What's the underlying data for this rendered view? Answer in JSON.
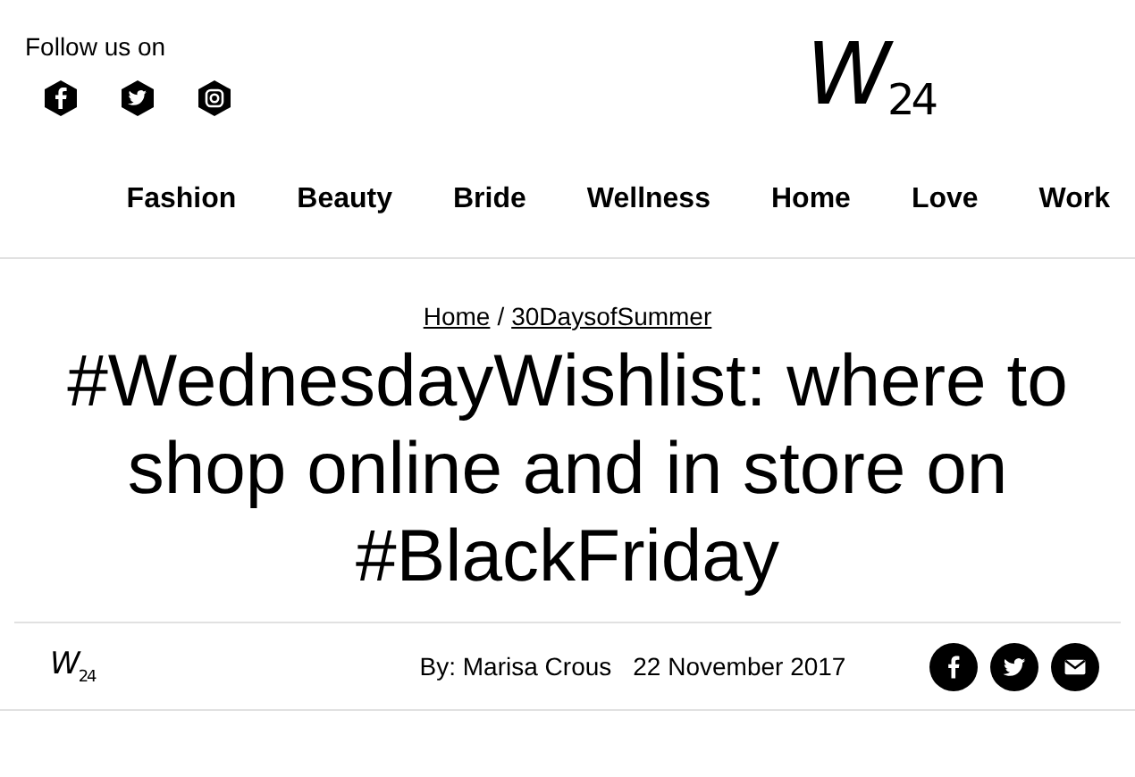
{
  "header": {
    "follow_label": "Follow us on",
    "social": [
      {
        "kind": "facebook"
      },
      {
        "kind": "twitter"
      },
      {
        "kind": "instagram"
      }
    ],
    "logo": "W$_{24}$"
  },
  "nav": [
    "Fashion",
    "Beauty",
    "Bride",
    "Wellness",
    "Home",
    "Love",
    "Work"
  ],
  "breadcrumb": [
    "Home",
    "30DaysofSummer"
  ],
  "breadcrumb_separator": "/",
  "title": "#WednesdayWishlist: where to shop online and in store on #BlackFriday",
  "byline": {
    "logo": "W$_{24}$",
    "author": "By: Marisa Crous",
    "date": "22 November 2017",
    "share": [
      {
        "kind": "facebook"
      },
      {
        "kind": "twitter"
      },
      {
        "kind": "email"
      }
    ]
  }
}
